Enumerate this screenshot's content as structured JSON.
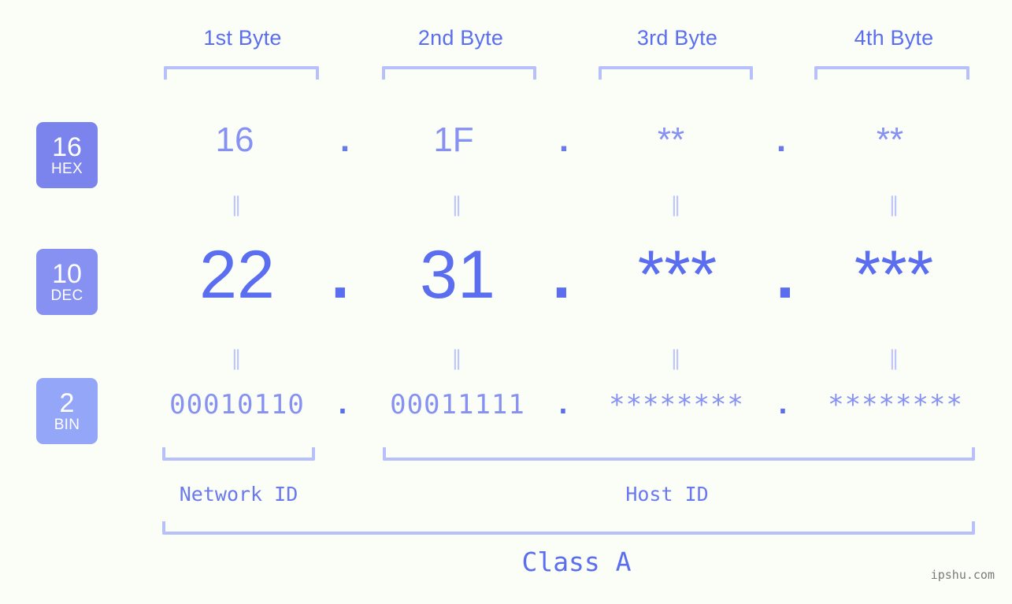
{
  "background_color": "#fbfdf7",
  "accent_color": "#5b6ef0",
  "muted_accent_color": "#8691f2",
  "bracket_color": "#b8c0fb",
  "byte_headers": [
    {
      "label": "1st Byte"
    },
    {
      "label": "2nd Byte"
    },
    {
      "label": "3rd Byte"
    },
    {
      "label": "4th Byte"
    }
  ],
  "radix_badges": [
    {
      "number": "16",
      "label": "HEX",
      "color": "#7b84ec"
    },
    {
      "number": "10",
      "label": "DEC",
      "color": "#8691f2"
    },
    {
      "number": "2",
      "label": "BIN",
      "color": "#94a6f7"
    }
  ],
  "rows": {
    "hex": {
      "radix": "16",
      "radix_label": "HEX",
      "values": [
        "16",
        "1F",
        "**",
        "**"
      ],
      "separator": "."
    },
    "dec": {
      "radix": "10",
      "radix_label": "DEC",
      "values": [
        "22",
        "31",
        "***",
        "***"
      ],
      "separator": "."
    },
    "bin": {
      "radix": "2",
      "radix_label": "BIN",
      "values": [
        "00010110",
        "00011111",
        "********",
        "********"
      ],
      "separator": "."
    }
  },
  "equivalence_symbol": "‖",
  "id_sections": [
    {
      "label": "Network ID"
    },
    {
      "label": "Host ID"
    }
  ],
  "class_label": "Class A",
  "watermark": "ipshu.com"
}
